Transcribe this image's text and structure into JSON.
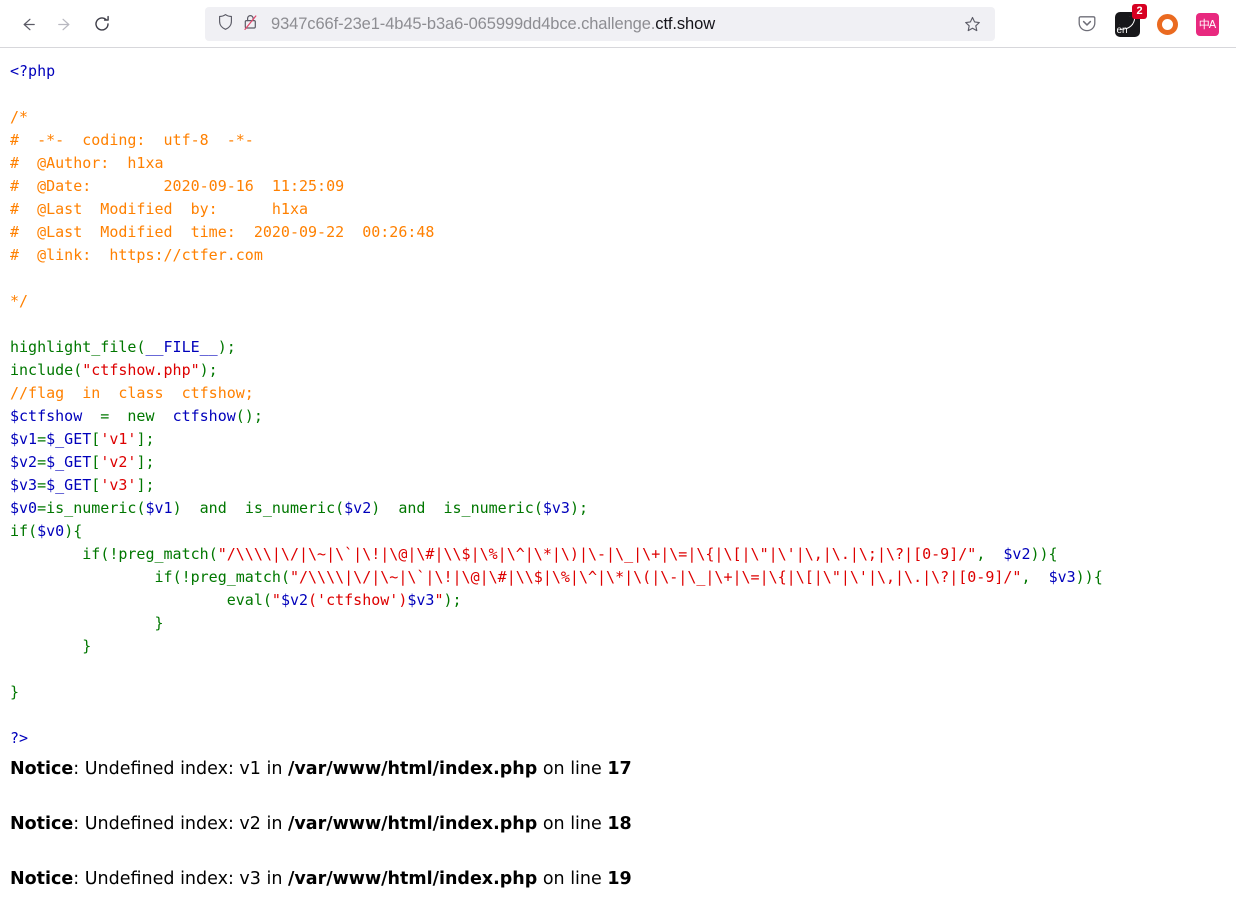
{
  "browser": {
    "back_label": "Back",
    "forward_label": "Forward",
    "reload_label": "Reload",
    "shield_label": "shield-icon",
    "lock_label": "lock-crossed-icon",
    "url_prefix": "9347c66f-23e1-4b45-b3a6-065999dd4bce.challenge.",
    "url_domain": "ctf.show",
    "url_full": "9347c66f-23e1-4b45-b3a6-065999dd4bce.challenge.ctf.show",
    "bookmark_label": "Bookmark this page",
    "pocket_label": "Save to Pocket",
    "extension_en_label": "en",
    "extension_badge_count": "2",
    "extension_circle_label": "Opera extension",
    "extension_translate_label": "中A"
  },
  "colors": {
    "php_default": "#0000BB",
    "php_keyword": "#007700",
    "php_string": "#DD0000",
    "php_comment": "#FF8000",
    "urlbar_bg": "#f0f0f4",
    "badge_red": "#d70022",
    "translate_pink": "#e8297f",
    "circle_orange": "#ea6a20"
  },
  "source": {
    "open_tag": "<?php",
    "close_tag": "?>",
    "comment_block": [
      "/*",
      "#  -*-  coding:  utf-8  -*-",
      "#  @Author:  h1xa",
      "#  @Date:        2020-09-16  11:25:09",
      "#  @Last  Modified  by:      h1xa",
      "#  @Last  Modified  time:  2020-09-22  00:26:48",
      "#  @link:  https://ctfer.com",
      "",
      "*/"
    ],
    "comment_inline": "//flag  in  class  ctfshow;",
    "fn_highlight_file": "highlight_file",
    "const_file": "__FILE__",
    "fn_include": "include",
    "str_ctfshow_php": "\"ctfshow.php\"",
    "var_ctfshow": "$ctfshow",
    "kw_new": "new",
    "cls_ctfshow": "ctfshow",
    "var_v1": "$v1",
    "var_v2": "$v2",
    "var_v3": "$v3",
    "var_v0": "$v0",
    "superglobal_get": "$_GET",
    "key_v1": "'v1'",
    "key_v2": "'v2'",
    "key_v3": "'v3'",
    "fn_is_numeric": "is_numeric",
    "kw_and": "and",
    "kw_if": "if",
    "fn_preg_match": "preg_match",
    "fn_eval": "eval",
    "regex_v2": "\"/\\\\\\\\|\\/|\\~|\\`|\\!|\\@|\\#|\\\\$|\\%|\\^|\\*|\\)|\\-|\\_|\\+|\\=|\\{|\\[|\\\"|\\'|\\,|\\.|\\;|\\?|[0-9]/\"",
    "regex_v3": "\"/\\\\\\\\|\\/|\\~|\\`|\\!|\\@|\\#|\\\\$|\\%|\\^|\\*|\\(|\\-|\\_|\\+|\\=|\\{|\\[|\\\"|\\'|\\,|\\.|\\?|[0-9]/\"",
    "eval_string": "\"$v2('ctfshow')$v3\""
  },
  "notices": [
    {
      "label": "Notice",
      "message": ": Undefined index: v1 in ",
      "file": "/var/www/html/index.php",
      "online": " on line ",
      "line": "17"
    },
    {
      "label": "Notice",
      "message": ": Undefined index: v2 in ",
      "file": "/var/www/html/index.php",
      "online": " on line ",
      "line": "18"
    },
    {
      "label": "Notice",
      "message": ": Undefined index: v3 in ",
      "file": "/var/www/html/index.php",
      "online": " on line ",
      "line": "19"
    }
  ]
}
